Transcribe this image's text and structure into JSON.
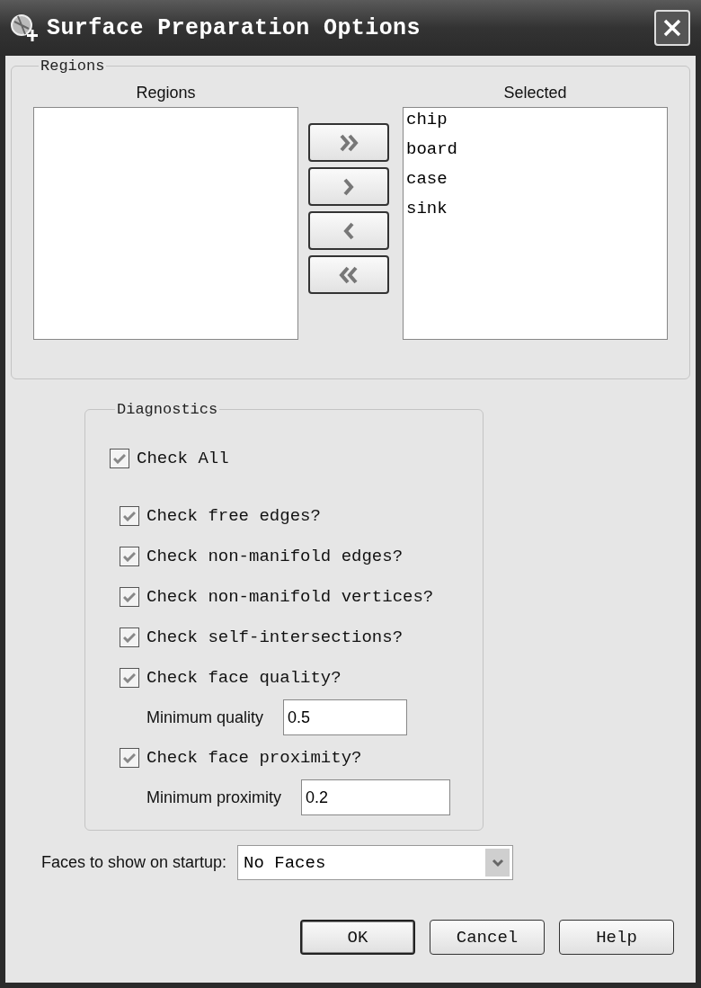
{
  "window": {
    "title": "Surface Preparation Options"
  },
  "regions_group": {
    "title": "Regions",
    "available": {
      "label": "Regions"
    },
    "transfer_buttons": [
      {
        "kind": "add_all"
      },
      {
        "kind": "add"
      },
      {
        "kind": "remove"
      },
      {
        "kind": "remove_all"
      }
    ],
    "selected": {
      "label": "Selected",
      "items": [
        "chip",
        "board",
        "case",
        "sink"
      ]
    }
  },
  "diagnostics": {
    "title": "Diagnostics",
    "check_all": {
      "label": "Check All",
      "checked": true
    },
    "options": [
      {
        "kind": "checkbox",
        "label": "Check free edges?",
        "checked": true
      },
      {
        "kind": "checkbox",
        "label": "Check non-manifold edges?",
        "checked": true
      },
      {
        "kind": "checkbox",
        "label": "Check non-manifold vertices?",
        "checked": true
      },
      {
        "kind": "checkbox",
        "label": "Check self-intersections?",
        "checked": true
      },
      {
        "kind": "checkbox",
        "label": "Check face quality?",
        "checked": true
      },
      {
        "kind": "number_field",
        "label": "Minimum quality",
        "value": "0.5"
      },
      {
        "kind": "checkbox",
        "label": "Check face proximity?",
        "checked": true
      },
      {
        "kind": "number_field",
        "label": "Minimum proximity",
        "value": "0.2"
      }
    ]
  },
  "startup_faces": {
    "label": "Faces to show on startup:",
    "value": "No Faces"
  },
  "buttons": [
    {
      "label": "OK",
      "default": true
    },
    {
      "label": "Cancel",
      "default": false
    },
    {
      "label": "Help",
      "default": false
    }
  ]
}
